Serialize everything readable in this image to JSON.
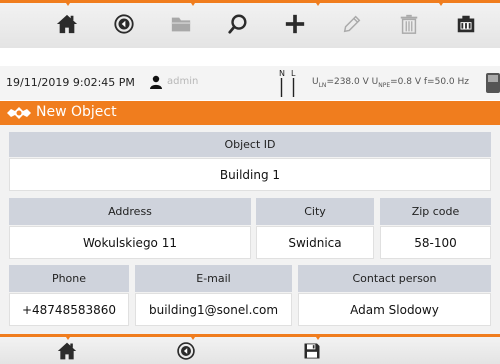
{
  "toolbar_top": {
    "icons": [
      "home-icon",
      "back-circle-icon",
      "folder-icon",
      "search-icon",
      "plus-icon",
      "pencil-icon",
      "trash-icon",
      "memory-card-icon"
    ]
  },
  "status": {
    "datetime": "19/11/2019 9:02:45 PM",
    "user": "admin",
    "nl_n": "N",
    "nl_l": "L",
    "uln_label": "U",
    "uln_sub": "LN",
    "uln_value": "=238.0 V",
    "upe_label": "U",
    "upe_sub": "NPE",
    "upe_value": "=0.8 V",
    "freq": "f=50.0 Hz"
  },
  "title": "New Object",
  "form": {
    "object_id_label": "Object ID",
    "object_id_value": "Building 1",
    "address_label": "Address",
    "address_value": "Wokulskiego 11",
    "city_label": "City",
    "city_value": "Swidnica",
    "zip_label": "Zip code",
    "zip_value": "58-100",
    "phone_label": "Phone",
    "phone_value": "+48748583860",
    "email_label": "E-mail",
    "email_value": "building1@sonel.com",
    "contact_label": "Contact person",
    "contact_value": "Adam Slodowy"
  },
  "toolbar_bottom": {
    "icons": [
      "home-icon",
      "back-circle-icon",
      "save-icon"
    ]
  },
  "colors": {
    "accent": "#f07d1e",
    "header_cell": "#cfd3dc",
    "icon_dark": "#2b2b2b",
    "icon_disabled": "#aaaaaa"
  }
}
